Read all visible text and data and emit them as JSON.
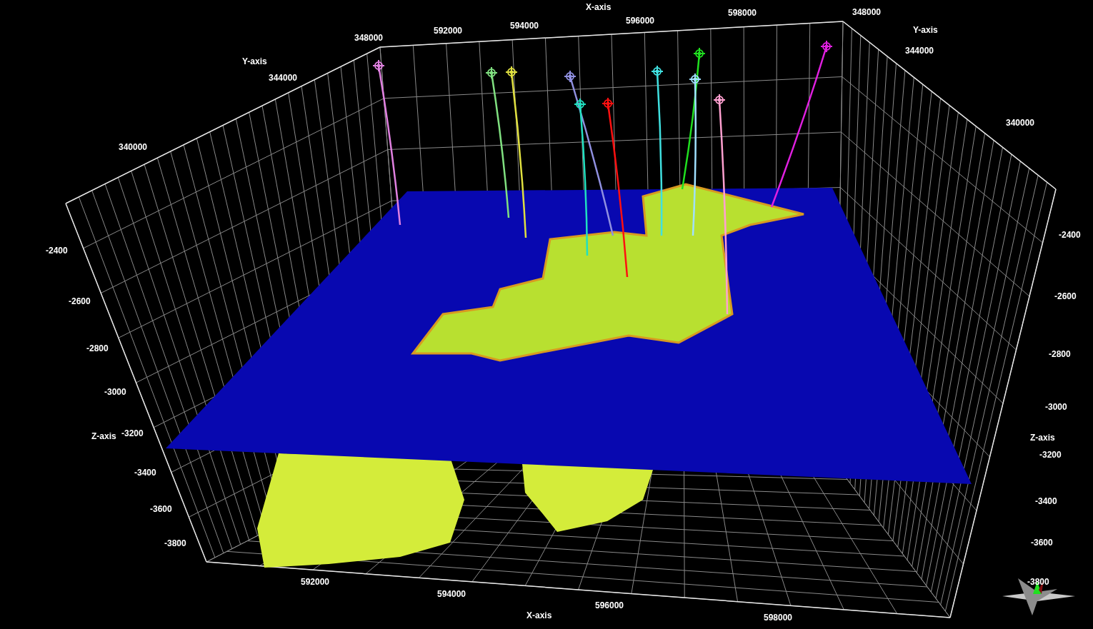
{
  "view_3d": {
    "axis_titles": [
      "X-axis",
      "Y-axis",
      "Y-axis",
      "Z-axis",
      "Z-axis",
      "X-axis"
    ],
    "tick_labels": [
      "592000",
      "594000",
      "596000",
      "598000",
      "348000",
      "344000",
      "340000",
      "348000",
      "344000",
      "340000",
      "-2400",
      "-2600",
      "-2800",
      "-3000",
      "-3200",
      "-3400",
      "-3600",
      "-3800",
      "-2400",
      "-2600",
      "-2800",
      "-3000",
      "-3200",
      "-3400",
      "-3600",
      "-3800",
      "592000",
      "594000",
      "596000",
      "598000"
    ],
    "wells": [
      {
        "color": "#e080e0"
      },
      {
        "color": "#80e080"
      },
      {
        "color": "#e0e040"
      },
      {
        "color": "#9090e0"
      },
      {
        "color": "#20e0c0"
      },
      {
        "color": "#ff1010"
      },
      {
        "color": "#40e0e0"
      },
      {
        "color": "#20e020"
      },
      {
        "color": "#a0e0ff"
      },
      {
        "color": "#ffa0d0"
      },
      {
        "color": "#e020e0"
      }
    ]
  }
}
